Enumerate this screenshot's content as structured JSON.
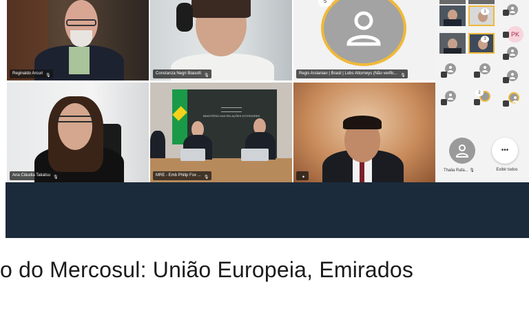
{
  "participants": [
    {
      "name": "Reginaldo Arcuri"
    },
    {
      "name": "Constanza Negri Biasutti"
    },
    {
      "name": "Regis Arslanian | Brasil | Lobs Attorneys (Não verific..."
    },
    {
      "name": "Ana Cláudia Takatsu"
    },
    {
      "name": "MRE - Emb Philip Fox ..."
    },
    {
      "name": ""
    }
  ],
  "regis_badge": "5",
  "sidebar": {
    "initials": "PK",
    "badges": [
      "1",
      "3",
      "2"
    ],
    "thalia_label": "Thalia Rafa...",
    "more_label": "Exibir todos",
    "more_glyph": "•••"
  },
  "room_sign": "MINISTÉRIO DAS RELAÇÕES EXTERIORES",
  "headline": "o do Mercosul: União Europeia, Emirados",
  "colors": {
    "banner": "#1c2b3b",
    "accent_ring": "#f0b93a",
    "avatar_gray": "#9a9a9a"
  }
}
